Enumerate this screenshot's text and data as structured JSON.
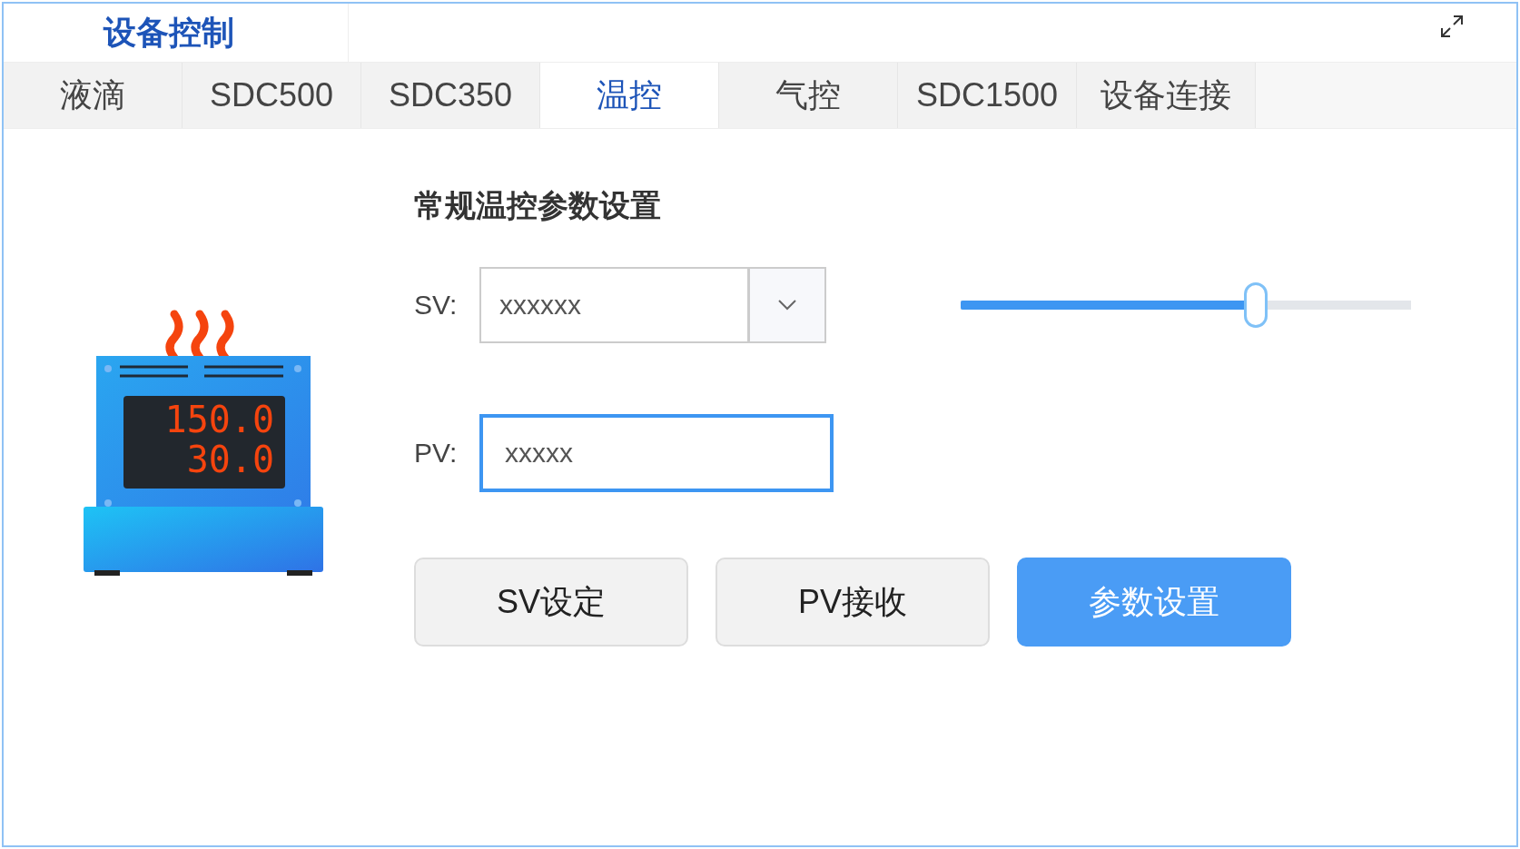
{
  "panel": {
    "title": "设备控制"
  },
  "tabs": [
    {
      "label": "液滴",
      "selected": false
    },
    {
      "label": "SDC500",
      "selected": false
    },
    {
      "label": "SDC350",
      "selected": false
    },
    {
      "label": "温控",
      "selected": true
    },
    {
      "label": "气控",
      "selected": false
    },
    {
      "label": "SDC1500",
      "selected": false
    },
    {
      "label": "设备连接",
      "selected": false
    }
  ],
  "device": {
    "display_lines": [
      "150.0",
      "30.0"
    ]
  },
  "section_title": "常规温控参数设置",
  "sv": {
    "label": "SV:",
    "value": "xxxxxx"
  },
  "pv": {
    "label": "PV:",
    "value": "xxxxx",
    "focused": true
  },
  "slider": {
    "level": 0.655
  },
  "buttons": [
    {
      "label": "SV设定",
      "kind": "default"
    },
    {
      "label": "PV接收",
      "kind": "default"
    },
    {
      "label": "参数设置",
      "kind": "primary"
    }
  ]
}
